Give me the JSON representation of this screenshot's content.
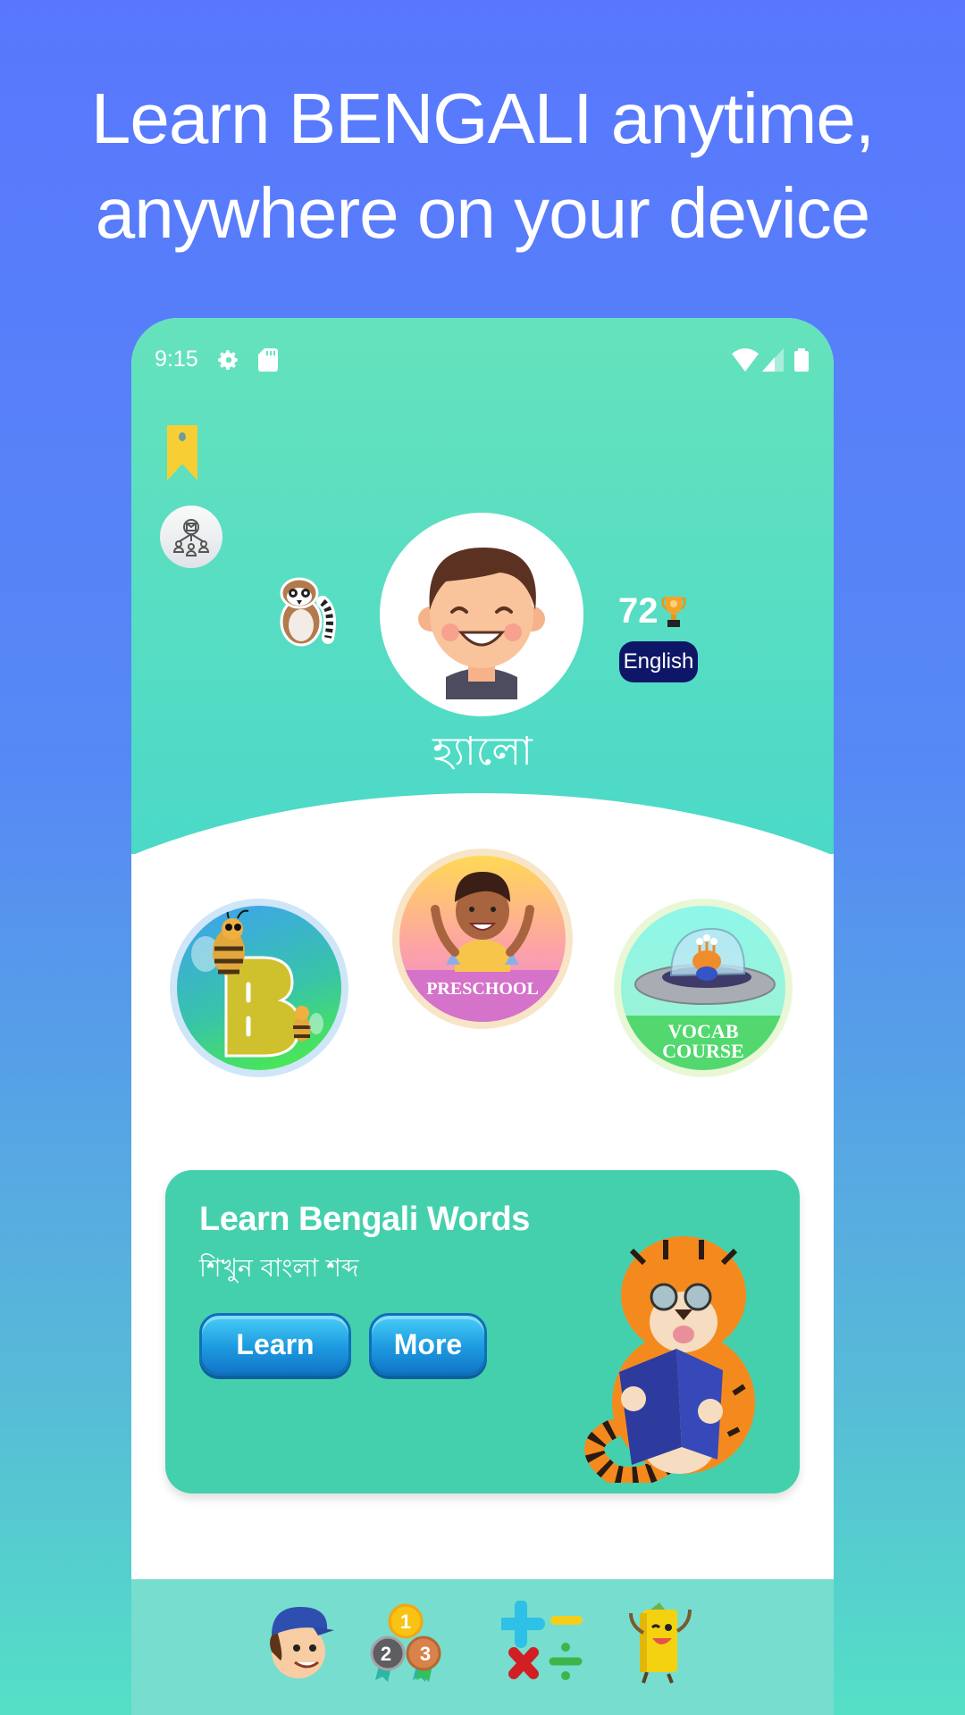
{
  "headline": {
    "line1": "Learn BENGALI anytime,",
    "line2": "anywhere on your device"
  },
  "status_bar": {
    "time": "9:15",
    "left_icons": [
      "gear-icon",
      "sd-card-icon"
    ],
    "right_icons": [
      "wifi-icon",
      "signal-icon",
      "battery-icon"
    ]
  },
  "profile": {
    "greeting": "হ্যালো",
    "score": "72",
    "language": "English"
  },
  "courses": [
    {
      "id": "alphabet",
      "label": "B"
    },
    {
      "id": "preschool",
      "label": "PRESCHOOL"
    },
    {
      "id": "vocab",
      "label_line1": "VOCAB",
      "label_line2": "COURSE"
    }
  ],
  "words_card": {
    "title": "Learn Bengali Words",
    "subtitle": "শিখুন বাংলা শব্দ",
    "learn_label": "Learn",
    "more_label": "More"
  },
  "bottom_nav": {
    "items": [
      "profile-boy",
      "medals-ranking",
      "math-operations",
      "book-reading"
    ]
  },
  "colors": {
    "page_bg_top": "#5877fd",
    "page_bg_bottom": "#54e0c6",
    "header_green": "#65e2bc",
    "card_green": "#45d0ad",
    "language_pill": "#0e1767",
    "button_blue": "#1d9ae0",
    "bottom_nav": "#77ddcf"
  }
}
